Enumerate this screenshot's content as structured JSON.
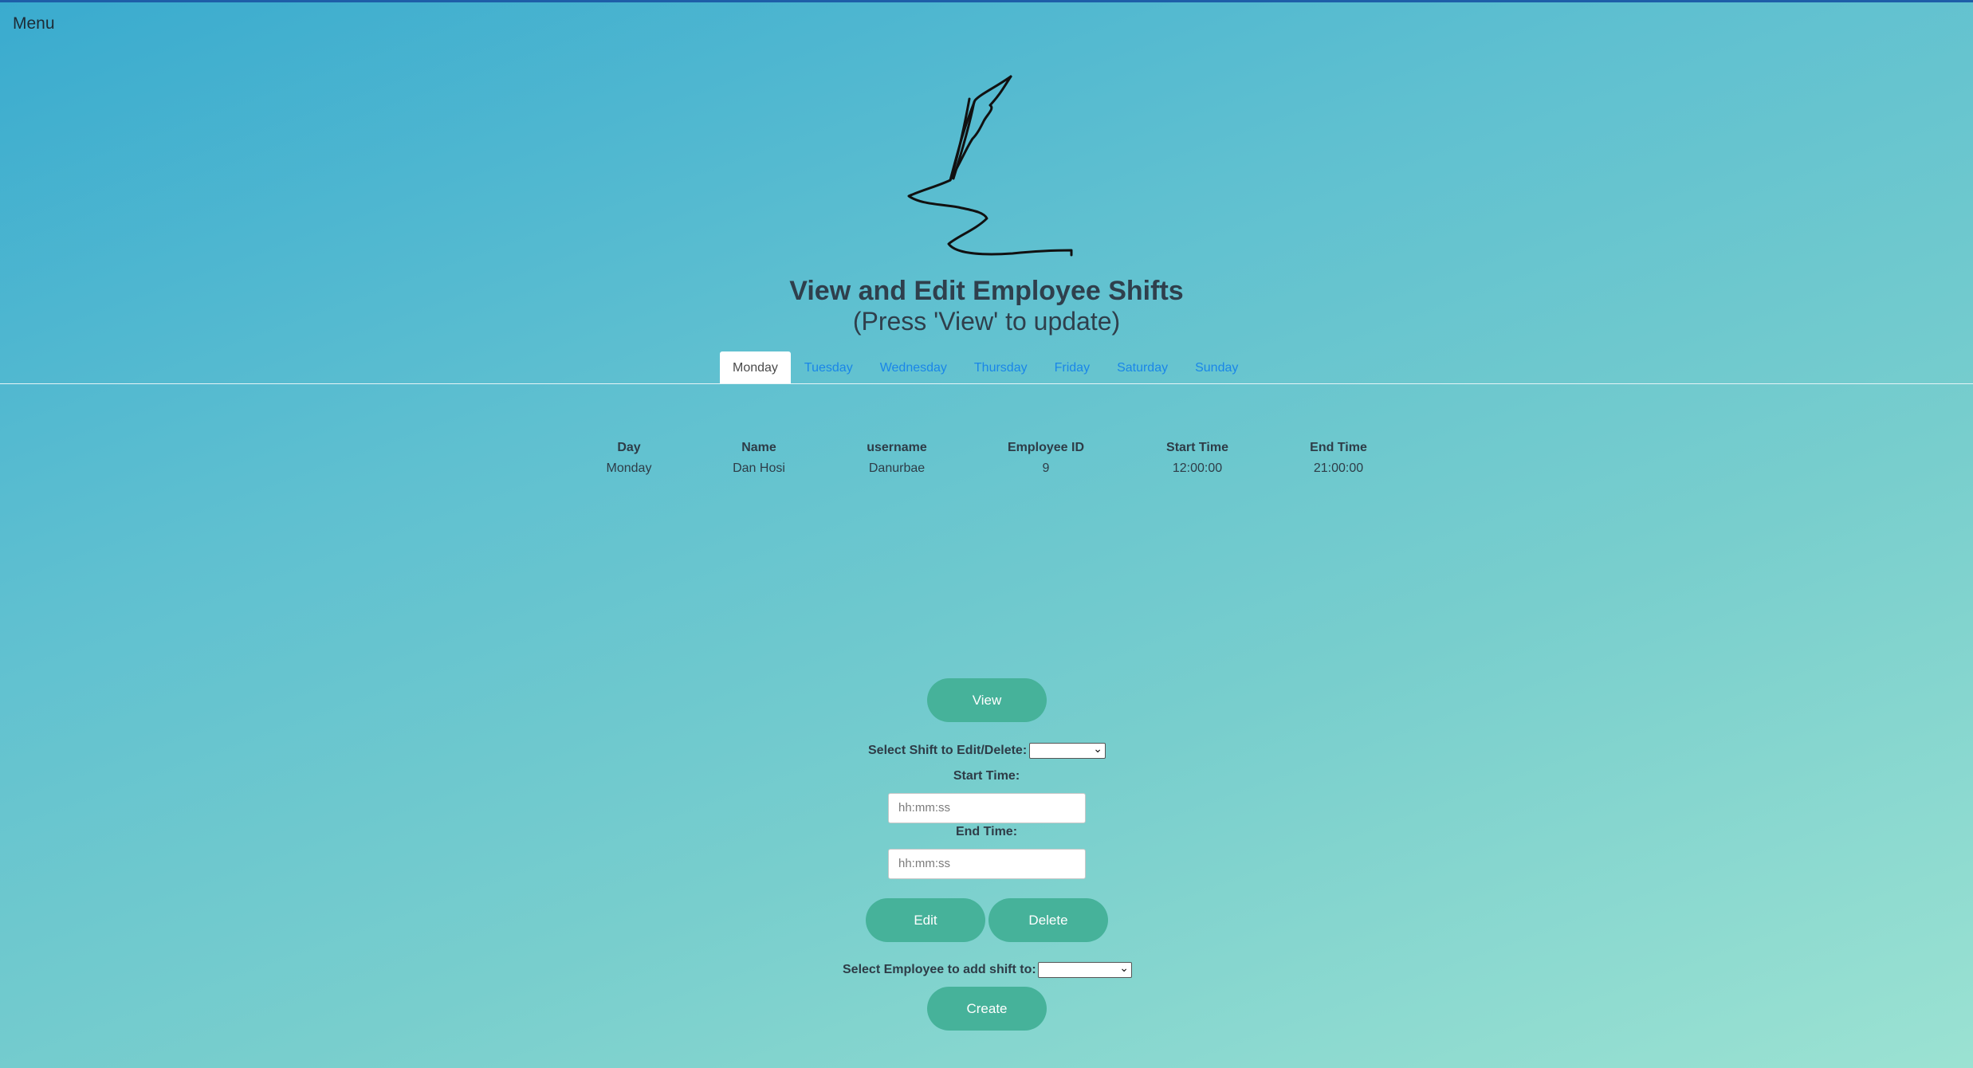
{
  "nav": {
    "menu_label": "Menu"
  },
  "header": {
    "title": "View and Edit Employee Shifts",
    "subtitle": "(Press 'View' to update)"
  },
  "tabs": [
    {
      "label": "Monday",
      "active": true
    },
    {
      "label": "Tuesday",
      "active": false
    },
    {
      "label": "Wednesday",
      "active": false
    },
    {
      "label": "Thursday",
      "active": false
    },
    {
      "label": "Friday",
      "active": false
    },
    {
      "label": "Saturday",
      "active": false
    },
    {
      "label": "Sunday",
      "active": false
    }
  ],
  "table": {
    "headers": [
      "Day",
      "Name",
      "username",
      "Employee ID",
      "Start Time",
      "End Time"
    ],
    "rows": [
      [
        "Monday",
        "Dan Hosi",
        "Danurbae",
        "9",
        "12:00:00",
        "21:00:00"
      ]
    ]
  },
  "form": {
    "view_button": "View",
    "select_shift_label": "Select Shift to Edit/Delete:",
    "start_time_label": "Start Time:",
    "start_time_placeholder": "hh:mm:ss",
    "end_time_label": "End Time:",
    "end_time_placeholder": "hh:mm:ss",
    "edit_button": "Edit",
    "delete_button": "Delete",
    "select_employee_label": "Select Employee to add shift to:",
    "create_button": "Create"
  },
  "colors": {
    "button": "#46b29a",
    "tab_link": "#1a86e8",
    "top_border": "#1e5ea8"
  }
}
